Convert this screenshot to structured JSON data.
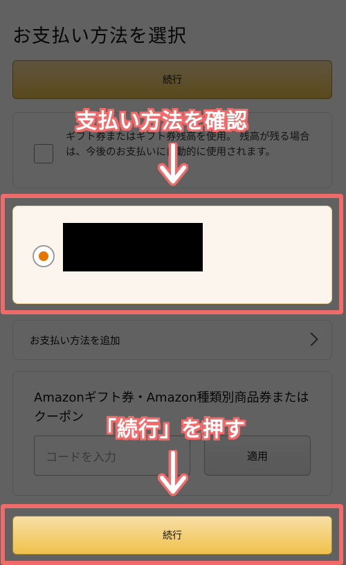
{
  "page": {
    "title": "お支払い方法を選択",
    "continue_label": "続行"
  },
  "gift_balance": {
    "text": "ギフト券またはギフト券残高を使用。 残高が残る場合は、今後のお支払いに自動的に使用されます。",
    "checked": false
  },
  "payment_method": {
    "selected": true,
    "details_redacted": true
  },
  "add_payment": {
    "label": "お支払い方法を追加"
  },
  "coupon": {
    "title": "Amazonギフト券・Amazon種類別商品券またはクーポン",
    "placeholder": "コードを入力",
    "apply_label": "適用"
  },
  "annotations": {
    "step1": "支払い方法を確認",
    "step2": "「続行」を押す",
    "highlight_color": "#f26b6b"
  }
}
